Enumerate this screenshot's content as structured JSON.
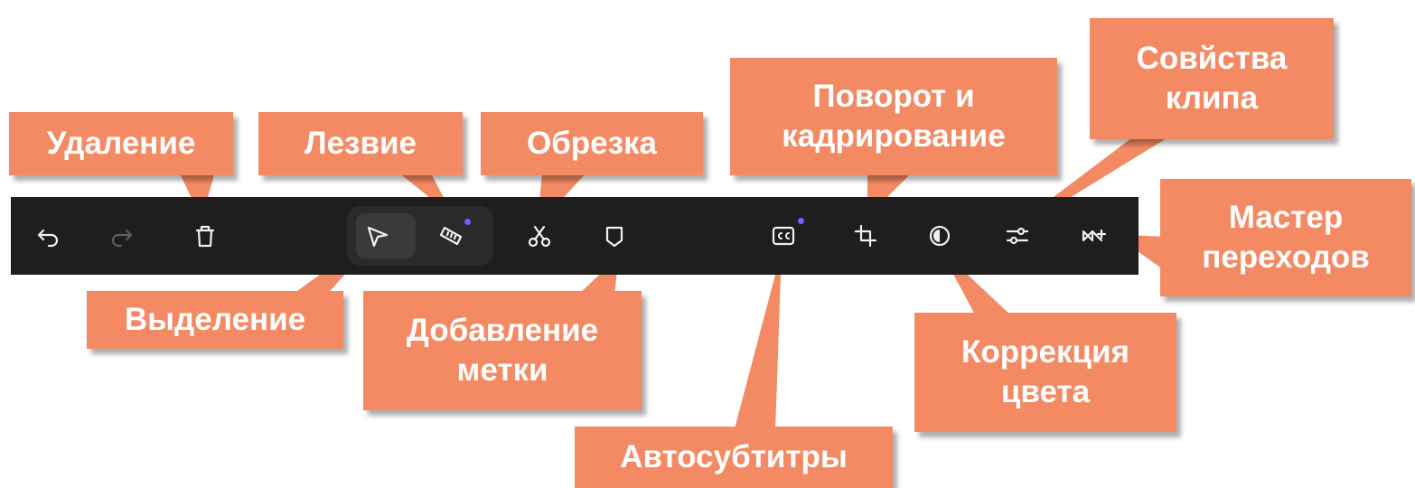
{
  "toolbar": {
    "buttons": [
      {
        "name": "undo",
        "icon": "undo-icon"
      },
      {
        "name": "redo",
        "icon": "redo-icon",
        "disabled": true
      },
      {
        "name": "delete",
        "icon": "trash-icon"
      },
      {
        "name": "select",
        "icon": "cursor-arrow-icon",
        "active": true
      },
      {
        "name": "blade",
        "icon": "blade-icon",
        "badge": true
      },
      {
        "name": "trim",
        "icon": "scissors-icon"
      },
      {
        "name": "add-marker",
        "icon": "marker-icon"
      },
      {
        "name": "auto-subtitles",
        "icon": "cc-icon",
        "badge": true
      },
      {
        "name": "rotate-crop",
        "icon": "crop-icon"
      },
      {
        "name": "color-correction",
        "icon": "contrast-icon"
      },
      {
        "name": "clip-properties",
        "icon": "sliders-icon"
      },
      {
        "name": "transition-wizard",
        "icon": "transition-icon"
      }
    ],
    "badge_color": "#7b5cff",
    "background": "#1e1e1e"
  },
  "callouts": {
    "delete": "Удаление",
    "blade": "Лезвие",
    "trim": "Обрезка",
    "rotate_crop": "Поворот и\nкадрирование",
    "clip_properties": "Совйства\nклипа",
    "transition_wizard": "Мастер\nпереходов",
    "select": "Выделение",
    "add_marker": "Добавление\nметки",
    "auto_subtitles": "Автосубтитры",
    "color_correction": "Коррекция\nцвета"
  },
  "colors": {
    "callout_bg": "#f38a63",
    "callout_text": "#ffffff"
  }
}
